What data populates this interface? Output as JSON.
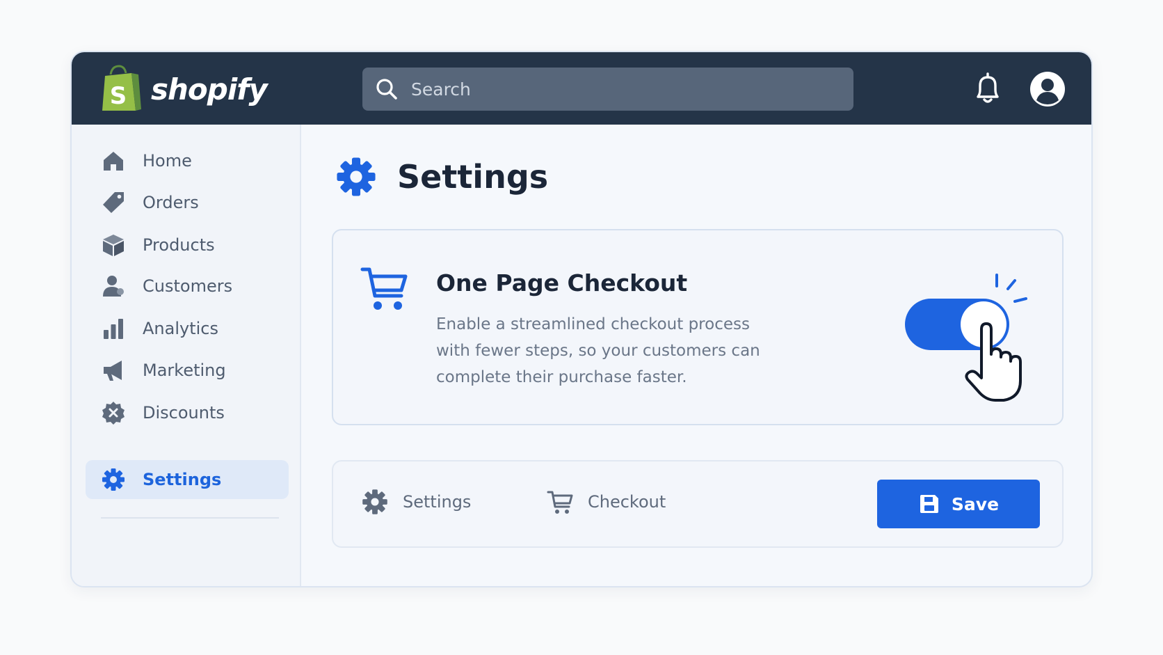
{
  "header": {
    "brand": "shopify",
    "logo_icon": "shopping-bag-logo-icon",
    "search_placeholder": "Search",
    "notification_icon": "bell-icon",
    "account_icon": "user-avatar-icon"
  },
  "sidebar": {
    "items": [
      {
        "label": "Home",
        "icon": "home-icon"
      },
      {
        "label": "Orders",
        "icon": "tag-icon"
      },
      {
        "label": "Products",
        "icon": "box-icon"
      },
      {
        "label": "Customers",
        "icon": "person-icon"
      },
      {
        "label": "Analytics",
        "icon": "bar-chart-icon"
      },
      {
        "label": "Marketing",
        "icon": "megaphone-icon"
      },
      {
        "label": "Discounts",
        "icon": "discount-badge-icon"
      },
      {
        "label": "Settings",
        "icon": "gear-icon",
        "active": true
      }
    ]
  },
  "page": {
    "title": "Settings",
    "title_icon": "gear-icon"
  },
  "checkout_card": {
    "icon": "cart-icon",
    "title": "One Page Checkout",
    "description": "Enable a streamlined checkout process with fewer steps, so your customers can complete their purchase faster.",
    "toggle_on": true
  },
  "bottom_bar": {
    "crumb_settings": "Settings",
    "crumb_checkout": "Checkout",
    "save_label": "Save"
  },
  "colors": {
    "accent": "#1e64e0",
    "header_bg": "#243448",
    "brand_green": "#95bf47"
  }
}
